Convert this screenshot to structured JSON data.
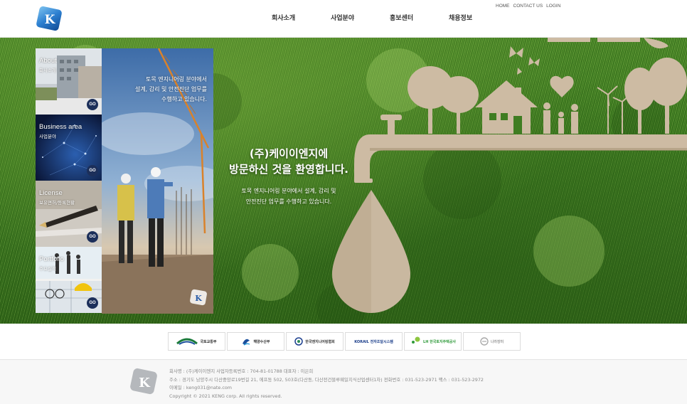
{
  "header": {
    "logo_letter": "K",
    "nav": [
      "회사소개",
      "사업분야",
      "홍보센터",
      "채용정보"
    ],
    "util_links": [
      "HOME",
      "CONTACT US",
      "LOGIN"
    ]
  },
  "side_panel": {
    "tiles": [
      {
        "title": "About",
        "subtitle": "회사소개",
        "go": "GO"
      },
      {
        "title": "Business area",
        "subtitle": "사업분야",
        "go": "GO"
      },
      {
        "title": "License",
        "subtitle": "보유면허/등록현황",
        "go": "GO"
      },
      {
        "title": "Portfolio",
        "subtitle": "주요실적",
        "go": "GO"
      }
    ],
    "photo_text": [
      "토목 엔지니어링 분야에서",
      "설계, 감리 및 안전진단 업무를",
      "수행하고 있습니다."
    ],
    "photo_logo": "K"
  },
  "welcome": {
    "line1": "(주)케이이엔지에",
    "line2": "방문하신 것을 환영합니다.",
    "desc1": "토목 엔지니어링 분야에서 설계, 감리 및",
    "desc2": "안전진단 업무를 수행하고 있습니다."
  },
  "partners": [
    {
      "label": "국토교통부",
      "color": "#1a7a3a"
    },
    {
      "label": "해양수산부",
      "color": "#1b4f9c"
    },
    {
      "label": "한국엔지니어링협회",
      "color": "#1c3f8f"
    },
    {
      "label": "KORAIL 전자조달시스템",
      "color": "#1a3d8a"
    },
    {
      "label": "LH 한국토지주택공사",
      "color": "#2f9a3a"
    },
    {
      "label": "나라장터",
      "color": "#999999"
    }
  ],
  "footer": {
    "logo_letter": "K",
    "line1": "회사명 : (주)케이이엔지    사업자등록번호 : 704-81-01788    대표자 : 이은희",
    "line2": "주소 : 경기도 남양주시 다산중앙로19번길 21, 에프동 502, 503호(다산동, 다산전건블루웨일지식산업센터1차)    전화번호 : 031-523-2971    팩스 : 031-523-2972",
    "line3": "이메일 : keng031@nate.com",
    "line4": "Copyright © 2021 KENG corp. All rights reserved."
  },
  "colors": {
    "brand_blue": "#1e5ea8",
    "go_button": "#1c2f5a",
    "grass": "#3f7d22",
    "paper_art": "#c9b8a0"
  }
}
